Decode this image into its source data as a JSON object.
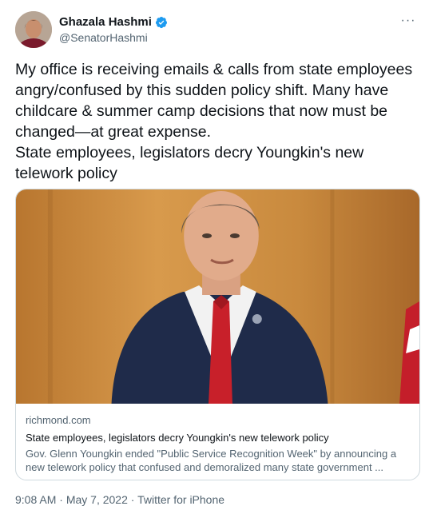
{
  "author": {
    "display_name": "Ghazala Hashmi",
    "handle": "@SenatorHashmi",
    "verified": true,
    "more_label": "···"
  },
  "tweet": {
    "text": "My office is receiving emails & calls from state employees angry/confused by this sudden policy shift. Many have childcare & summer camp decisions that now must be changed—at great expense.\nState employees, legislators decry Youngkin's new telework policy"
  },
  "card": {
    "domain": "richmond.com",
    "title": "State employees, legislators decry Youngkin's new telework policy",
    "description_line1": "Gov. Glenn Youngkin ended \"Public Service Recognition Week\" by announcing a",
    "description_line2": "new telework policy that confused and demoralized many state government ..."
  },
  "footer": {
    "time": "9:08 AM",
    "separator1": " · ",
    "date": "May 7, 2022",
    "separator2": " · ",
    "source": "Twitter for iPhone"
  },
  "colors": {
    "verified": "#1d9bf0",
    "muted": "#536471",
    "border": "#cfd9de"
  }
}
